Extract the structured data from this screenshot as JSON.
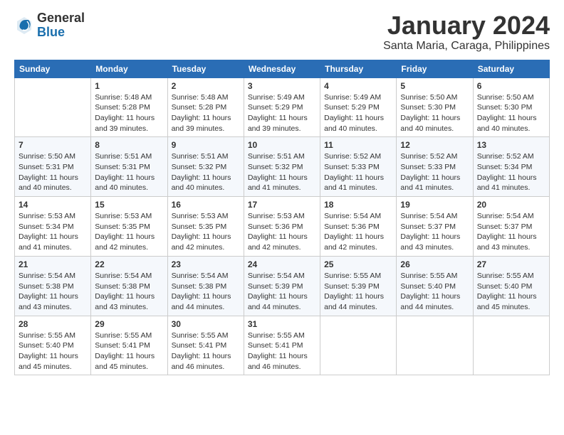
{
  "header": {
    "logo_general": "General",
    "logo_blue": "Blue",
    "month_year": "January 2024",
    "location": "Santa Maria, Caraga, Philippines"
  },
  "weekdays": [
    "Sunday",
    "Monday",
    "Tuesday",
    "Wednesday",
    "Thursday",
    "Friday",
    "Saturday"
  ],
  "weeks": [
    [
      {
        "day": "",
        "info": ""
      },
      {
        "day": "1",
        "info": "Sunrise: 5:48 AM\nSunset: 5:28 PM\nDaylight: 11 hours\nand 39 minutes."
      },
      {
        "day": "2",
        "info": "Sunrise: 5:48 AM\nSunset: 5:28 PM\nDaylight: 11 hours\nand 39 minutes."
      },
      {
        "day": "3",
        "info": "Sunrise: 5:49 AM\nSunset: 5:29 PM\nDaylight: 11 hours\nand 39 minutes."
      },
      {
        "day": "4",
        "info": "Sunrise: 5:49 AM\nSunset: 5:29 PM\nDaylight: 11 hours\nand 40 minutes."
      },
      {
        "day": "5",
        "info": "Sunrise: 5:50 AM\nSunset: 5:30 PM\nDaylight: 11 hours\nand 40 minutes."
      },
      {
        "day": "6",
        "info": "Sunrise: 5:50 AM\nSunset: 5:30 PM\nDaylight: 11 hours\nand 40 minutes."
      }
    ],
    [
      {
        "day": "7",
        "info": "Sunrise: 5:50 AM\nSunset: 5:31 PM\nDaylight: 11 hours\nand 40 minutes."
      },
      {
        "day": "8",
        "info": "Sunrise: 5:51 AM\nSunset: 5:31 PM\nDaylight: 11 hours\nand 40 minutes."
      },
      {
        "day": "9",
        "info": "Sunrise: 5:51 AM\nSunset: 5:32 PM\nDaylight: 11 hours\nand 40 minutes."
      },
      {
        "day": "10",
        "info": "Sunrise: 5:51 AM\nSunset: 5:32 PM\nDaylight: 11 hours\nand 41 minutes."
      },
      {
        "day": "11",
        "info": "Sunrise: 5:52 AM\nSunset: 5:33 PM\nDaylight: 11 hours\nand 41 minutes."
      },
      {
        "day": "12",
        "info": "Sunrise: 5:52 AM\nSunset: 5:33 PM\nDaylight: 11 hours\nand 41 minutes."
      },
      {
        "day": "13",
        "info": "Sunrise: 5:52 AM\nSunset: 5:34 PM\nDaylight: 11 hours\nand 41 minutes."
      }
    ],
    [
      {
        "day": "14",
        "info": "Sunrise: 5:53 AM\nSunset: 5:34 PM\nDaylight: 11 hours\nand 41 minutes."
      },
      {
        "day": "15",
        "info": "Sunrise: 5:53 AM\nSunset: 5:35 PM\nDaylight: 11 hours\nand 42 minutes."
      },
      {
        "day": "16",
        "info": "Sunrise: 5:53 AM\nSunset: 5:35 PM\nDaylight: 11 hours\nand 42 minutes."
      },
      {
        "day": "17",
        "info": "Sunrise: 5:53 AM\nSunset: 5:36 PM\nDaylight: 11 hours\nand 42 minutes."
      },
      {
        "day": "18",
        "info": "Sunrise: 5:54 AM\nSunset: 5:36 PM\nDaylight: 11 hours\nand 42 minutes."
      },
      {
        "day": "19",
        "info": "Sunrise: 5:54 AM\nSunset: 5:37 PM\nDaylight: 11 hours\nand 43 minutes."
      },
      {
        "day": "20",
        "info": "Sunrise: 5:54 AM\nSunset: 5:37 PM\nDaylight: 11 hours\nand 43 minutes."
      }
    ],
    [
      {
        "day": "21",
        "info": "Sunrise: 5:54 AM\nSunset: 5:38 PM\nDaylight: 11 hours\nand 43 minutes."
      },
      {
        "day": "22",
        "info": "Sunrise: 5:54 AM\nSunset: 5:38 PM\nDaylight: 11 hours\nand 43 minutes."
      },
      {
        "day": "23",
        "info": "Sunrise: 5:54 AM\nSunset: 5:38 PM\nDaylight: 11 hours\nand 44 minutes."
      },
      {
        "day": "24",
        "info": "Sunrise: 5:54 AM\nSunset: 5:39 PM\nDaylight: 11 hours\nand 44 minutes."
      },
      {
        "day": "25",
        "info": "Sunrise: 5:55 AM\nSunset: 5:39 PM\nDaylight: 11 hours\nand 44 minutes."
      },
      {
        "day": "26",
        "info": "Sunrise: 5:55 AM\nSunset: 5:40 PM\nDaylight: 11 hours\nand 44 minutes."
      },
      {
        "day": "27",
        "info": "Sunrise: 5:55 AM\nSunset: 5:40 PM\nDaylight: 11 hours\nand 45 minutes."
      }
    ],
    [
      {
        "day": "28",
        "info": "Sunrise: 5:55 AM\nSunset: 5:40 PM\nDaylight: 11 hours\nand 45 minutes."
      },
      {
        "day": "29",
        "info": "Sunrise: 5:55 AM\nSunset: 5:41 PM\nDaylight: 11 hours\nand 45 minutes."
      },
      {
        "day": "30",
        "info": "Sunrise: 5:55 AM\nSunset: 5:41 PM\nDaylight: 11 hours\nand 46 minutes."
      },
      {
        "day": "31",
        "info": "Sunrise: 5:55 AM\nSunset: 5:41 PM\nDaylight: 11 hours\nand 46 minutes."
      },
      {
        "day": "",
        "info": ""
      },
      {
        "day": "",
        "info": ""
      },
      {
        "day": "",
        "info": ""
      }
    ]
  ]
}
